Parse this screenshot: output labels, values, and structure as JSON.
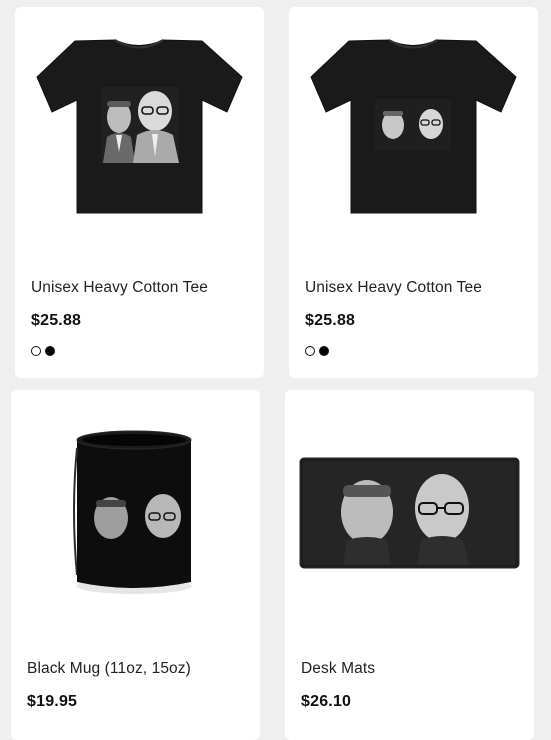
{
  "products": [
    {
      "title": "Unisex Heavy Cotton Tee",
      "price": "$25.88",
      "swatches": [
        "#ffffff",
        "#000000"
      ]
    },
    {
      "title": "Unisex Heavy Cotton Tee",
      "price": "$25.88",
      "swatches": [
        "#ffffff",
        "#000000"
      ]
    },
    {
      "title": "Black Mug (11oz, 15oz)",
      "price": "$19.95"
    },
    {
      "title": "Desk Mats",
      "price": "$26.10"
    }
  ]
}
